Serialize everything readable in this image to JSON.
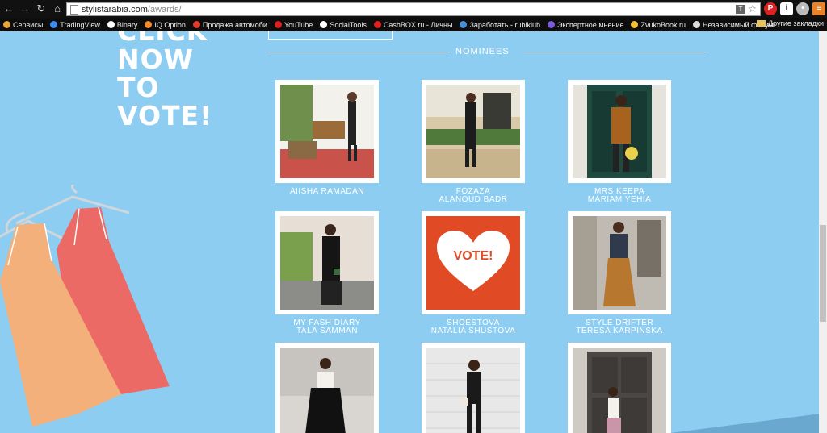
{
  "browser": {
    "url_domain": "stylistarabia.com",
    "url_path": "/awards/",
    "bookmarks": [
      {
        "label": "Сервисы",
        "color": "#e8a33a"
      },
      {
        "label": "TradingView",
        "color": "#3d8cf0"
      },
      {
        "label": "Binary",
        "color": "#ffffff"
      },
      {
        "label": "IQ Option",
        "color": "#f08a2a"
      },
      {
        "label": "Продажа автомоби",
        "color": "#e23a2a"
      },
      {
        "label": "YouTube",
        "color": "#e02020"
      },
      {
        "label": "SocialTools",
        "color": "#ffffff"
      },
      {
        "label": "CashBOX.ru - Личны",
        "color": "#e02020"
      },
      {
        "label": "Заработать - rublklub",
        "color": "#4a90d9"
      },
      {
        "label": "Экспертное мнение",
        "color": "#7b5bd6"
      },
      {
        "label": "ZvukoBook.ru",
        "color": "#f2c230"
      },
      {
        "label": "Независимый форум",
        "color": "#dddddd"
      }
    ],
    "bookmarks_more": "»",
    "other_bookmarks": "Другие закладки"
  },
  "page": {
    "cta_lines": [
      "CLICK",
      "NOW",
      "TO",
      "VOTE!"
    ],
    "nominees_title": "NOMINEES",
    "vote_label": "VOTE!",
    "nominees": [
      {
        "line1": "AIISHA RAMADAN",
        "line2": ""
      },
      {
        "line1": "FOZAZA",
        "line2": "ALANOUD BADR"
      },
      {
        "line1": "MRS KEEPA",
        "line2": "MARIAM YEHIA"
      },
      {
        "line1": "MY FASH DIARY",
        "line2": "TALA SAMMAN"
      },
      {
        "line1": "SHOESTOVA",
        "line2": "NATALIA SHUSTOVA"
      },
      {
        "line1": "STYLE DRIFTER",
        "line2": "TERESA KARPINSKA"
      }
    ]
  },
  "colors": {
    "page_bg": "#8ecdf2",
    "vote_red": "#e04b25",
    "dress_orange": "#f4b07a",
    "dress_red": "#ec6a66"
  }
}
